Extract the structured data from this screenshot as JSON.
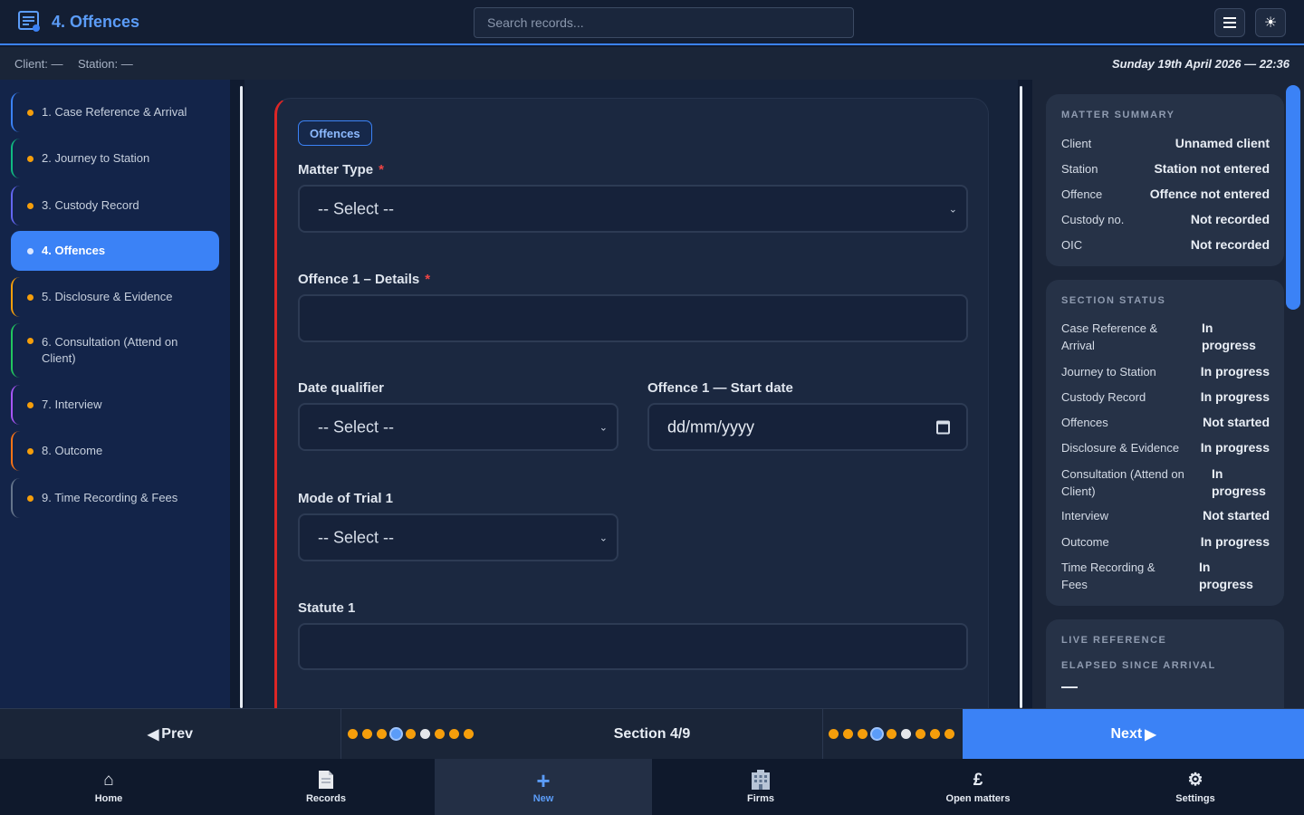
{
  "header": {
    "title": "4. Offences",
    "search_placeholder": "Search records...",
    "menu_icon": "hamburger-menu-icon",
    "theme_icon": "sun-icon"
  },
  "context": {
    "client_label": "Client: —",
    "station_label": "Station: —",
    "datetime": "Sunday 19th April 2026 — 22:36"
  },
  "sidebar": {
    "items": [
      {
        "label": "1. Case Reference & Arrival",
        "accent": "#3b82f6"
      },
      {
        "label": "2. Journey to Station",
        "accent": "#10b981"
      },
      {
        "label": "3. Custody Record",
        "accent": "#6366f1"
      },
      {
        "label": "4. Offences",
        "accent": "#ef4444"
      },
      {
        "label": "5. Disclosure & Evidence",
        "accent": "#f59e0b"
      },
      {
        "label": "6. Consultation (Attend on Client)",
        "accent": "#22c55e"
      },
      {
        "label": "7. Interview",
        "accent": "#a855f7"
      },
      {
        "label": "8. Outcome",
        "accent": "#f97316"
      },
      {
        "label": "9. Time Recording & Fees",
        "accent": "#64748b"
      }
    ]
  },
  "form": {
    "badge": "Offences",
    "matter_type_label": "Matter Type",
    "matter_type_value": "-- Select --",
    "offence_details_label": "Offence 1 – Details",
    "offence_details_value": "",
    "date_qualifier_label": "Date qualifier",
    "date_qualifier_value": "-- Select --",
    "start_date_label": "Offence 1 — Start date",
    "start_date_placeholder": "dd/mm/yyyy",
    "mode_of_trial_label": "Mode of Trial 1",
    "mode_of_trial_value": "-- Select --",
    "statute_label": "Statute 1",
    "statute_value": "",
    "required_marker": "*"
  },
  "matter_summary": {
    "heading": "MATTER SUMMARY",
    "rows": [
      {
        "key": "Client",
        "value": "Unnamed client"
      },
      {
        "key": "Station",
        "value": "Station not entered"
      },
      {
        "key": "Offence",
        "value": "Offence not entered"
      },
      {
        "key": "Custody no.",
        "value": "Not recorded"
      },
      {
        "key": "OIC",
        "value": "Not recorded"
      }
    ]
  },
  "section_status": {
    "heading": "SECTION STATUS",
    "rows": [
      {
        "key": "Case Reference & Arrival",
        "value": "In progress"
      },
      {
        "key": "Journey to Station",
        "value": "In progress"
      },
      {
        "key": "Custody Record",
        "value": "In progress"
      },
      {
        "key": "Offences",
        "value": "Not started"
      },
      {
        "key": "Disclosure & Evidence",
        "value": "In progress"
      },
      {
        "key": "Consultation (Attend on Client)",
        "value": "In progress"
      },
      {
        "key": "Interview",
        "value": "Not started"
      },
      {
        "key": "Outcome",
        "value": "In progress"
      },
      {
        "key": "Time Recording & Fees",
        "value": "In progress"
      }
    ]
  },
  "live_reference": {
    "heading": "LIVE REFERENCE",
    "sub_heading": "ELAPSED SINCE ARRIVAL",
    "value": "—"
  },
  "pager": {
    "prev_label": "Prev",
    "next_label": "Next",
    "section_label": "Section 4/9",
    "current_section": 4,
    "total_sections": 9,
    "dot_states": [
      "progress",
      "progress",
      "progress",
      "current",
      "progress",
      "not-started",
      "progress",
      "progress",
      "progress"
    ]
  },
  "bottom_nav": {
    "items": [
      {
        "label": "Home",
        "icon": "home-icon"
      },
      {
        "label": "Records",
        "icon": "document-icon"
      },
      {
        "label": "New",
        "icon": "plus-icon"
      },
      {
        "label": "Firms",
        "icon": "building-icon"
      },
      {
        "label": "Open matters",
        "icon": "pound-icon"
      },
      {
        "label": "Settings",
        "icon": "gear-icon"
      }
    ],
    "active": "New"
  },
  "colors": {
    "accent": "#3b82f6",
    "in_progress_dot": "#f59e0b",
    "required": "#ef4444",
    "active_card_border": "#dc2626"
  }
}
